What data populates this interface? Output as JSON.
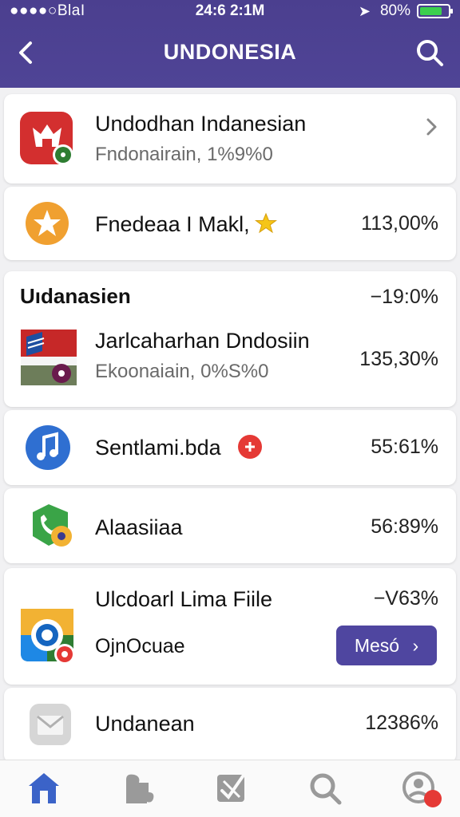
{
  "status_bar": {
    "carrier": "●●●●○BlаI",
    "time": "24:6 2:1M",
    "battery_percent": "80%",
    "battery_level": 0.8
  },
  "header": {
    "title": "UNDONESIA"
  },
  "cards": {
    "top": {
      "title": "Undodhan Indanesian",
      "subtitle": "Fndonairain, 1%9%0"
    },
    "featured": {
      "title": "Fnedeaa I Makl,",
      "value": "113,00%"
    },
    "section": {
      "title": "Uıdanasien",
      "value": "−19:0%",
      "item_title": "Jarlcaharhan Dndosiin",
      "item_subtitle": "Ekoonaiain, 0%S%0",
      "item_value": "135,30%"
    },
    "music": {
      "title": "Sentlami.bda",
      "value": "55:61%"
    },
    "phone": {
      "title": "Alaasiiaa",
      "value": "56:89%"
    },
    "files": {
      "title": "Ulcdoarl Lima Fiile",
      "value": "−V63%",
      "subtitle": "OjnOcuae",
      "button_label": "Mesó"
    },
    "mail": {
      "title": "Undanean",
      "value": "12386%"
    }
  },
  "colors": {
    "header_bg": "#4b3f8f",
    "accent_button": "#4f46a0",
    "active_nav": "#3b63c8",
    "badge_red": "#e53935"
  }
}
